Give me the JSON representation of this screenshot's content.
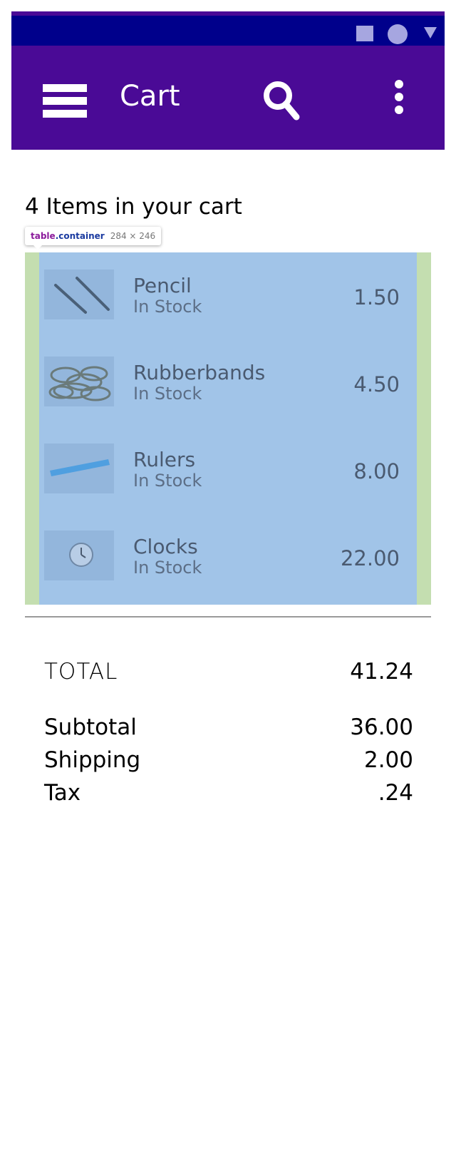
{
  "app_bar": {
    "title": "Cart",
    "menu_icon": "hamburger-menu-icon",
    "search_icon": "search-icon",
    "overflow_icon": "more-vertical-icon",
    "color": "#4a0a96"
  },
  "status_bar": {
    "color": "#00008b",
    "icons": [
      "square-icon",
      "circle-icon",
      "triangle-icon"
    ]
  },
  "cart": {
    "heading": "4 Items in your cart",
    "items": [
      {
        "name": "Pencil",
        "stock": "In Stock",
        "price": "1.50",
        "image": "pencil-image"
      },
      {
        "name": "Rubberbands",
        "stock": "In Stock",
        "price": "4.50",
        "image": "rubberbands-image"
      },
      {
        "name": "Rulers",
        "stock": "In Stock",
        "price": "8.00",
        "image": "ruler-image"
      },
      {
        "name": "Clocks",
        "stock": "In Stock",
        "price": "22.00",
        "image": "clock-image"
      }
    ]
  },
  "inspector_tooltip": {
    "tag": "table",
    "class": ".container",
    "size": "284 × 246"
  },
  "summary": {
    "total_label": "TOTAL",
    "total_value": "41.24",
    "subtotal_label": "Subtotal",
    "subtotal_value": "36.00",
    "shipping_label": "Shipping",
    "shipping_value": "2.00",
    "tax_label": "Tax",
    "tax_value": ".24"
  }
}
